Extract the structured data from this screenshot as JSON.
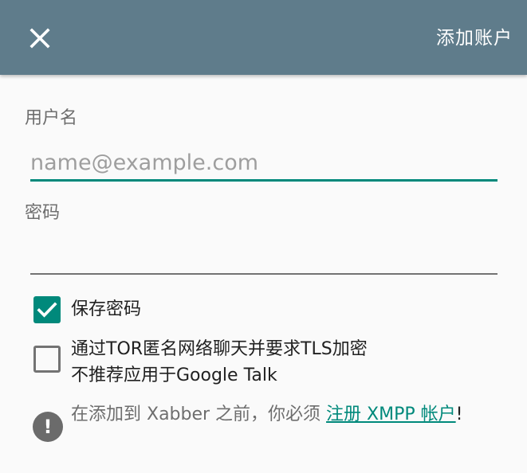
{
  "app_bar": {
    "close_icon": "close-icon",
    "action_label": "添加账户"
  },
  "form": {
    "username": {
      "label": "用户名",
      "value": "",
      "placeholder": "name@example.com"
    },
    "password": {
      "label": "密码",
      "value": "",
      "placeholder": ""
    }
  },
  "options": {
    "save_password": {
      "label": "保存密码",
      "checked": true
    },
    "tor": {
      "label_line1": "通过TOR匿名网络聊天并要求TLS加密",
      "label_line2": "不推荐应用于Google Talk",
      "checked": false
    }
  },
  "notice": {
    "icon": "exclamation-icon",
    "text": "在添加到 Xabber 之前，你必须 ",
    "link_text": "注册 XMPP 帐户",
    "end_text": "!"
  },
  "colors": {
    "app_bar": "#5f7c8b",
    "accent": "#00897b",
    "inactive_line": "#737373",
    "background": "#fafafa"
  }
}
